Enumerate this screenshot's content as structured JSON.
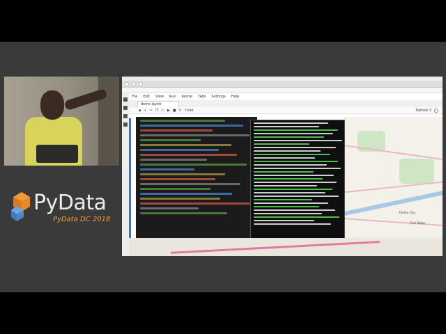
{
  "colors": {
    "stage_background": "#3a3a3a",
    "pydata_logo_text": "#eaeaea",
    "conference_text": "#f0a040",
    "jupyter_accent": "#2f76c6",
    "terminal_background": "#0f0f0f"
  },
  "branding": {
    "logo_text": "PyData",
    "conference": "PyData DC 2018"
  },
  "jupyterlab": {
    "menu": [
      "File",
      "Edit",
      "View",
      "Run",
      "Kernel",
      "Tabs",
      "Settings",
      "Help"
    ],
    "tab": "demo.ipynb",
    "cell_type": "Code",
    "kernel_name": "Python 3"
  },
  "map": {
    "labels": [
      "Fairfax City",
      "Fort Totten"
    ]
  },
  "icons": [
    "speaker-video",
    "pydata-logo",
    "file-browser-icon",
    "running-icon",
    "commands-icon",
    "extension-icon"
  ]
}
